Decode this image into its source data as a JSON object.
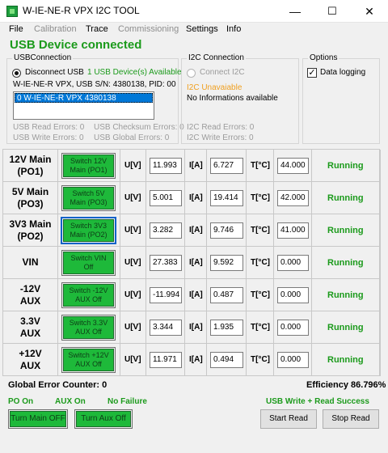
{
  "window": {
    "title": "W-IE-NE-R VPX I2C TOOL",
    "minimize_glyph": "—",
    "maximize_glyph": "☐",
    "close_glyph": "✕"
  },
  "menu": {
    "file": "File",
    "calibration": "Calibration",
    "trace": "Trace",
    "commissioning": "Commissioning",
    "settings": "Settings",
    "info": "Info"
  },
  "status": {
    "usb": "USB Device connected"
  },
  "usb": {
    "title": "USBConnection",
    "disconnect_label": "Disconnect USB",
    "available": "1 USB Device(s) Available",
    "device_info": "W-IE-NE-R VPX, USB S/N: 4380138, PID: 0018, V",
    "list_item": "0 W-IE-NE-R VPX 4380138",
    "read_errors": "USB Read Errors: 0",
    "checksum_errors": "USB Checksum Errors: 0",
    "write_errors": "USB Write Errors: 0",
    "global_errors": "USB Global Errors: 0"
  },
  "i2c": {
    "title": "I2C Connection",
    "connect_label": "Connect I2C",
    "unavailable": "I2C Unavaiable",
    "no_info": "No Informations available",
    "read_errors": "I2C Read Errors: 0",
    "write_errors": "I2C Write Errors: 0"
  },
  "options": {
    "title": "Options",
    "logging_label": "Data logging",
    "logging_checked": "✓"
  },
  "columns": {
    "voltage": "U[V]",
    "current": "I[A]",
    "temperature": "T[°C]"
  },
  "rows": [
    {
      "label": "12V Main\n(PO1)",
      "switch": "Switch 12V\nMain (PO1)",
      "u": "11.993",
      "i": "6.727",
      "t": "44.000",
      "state": "Running"
    },
    {
      "label": "5V Main\n(PO3)",
      "switch": "Switch 5V\nMain (PO3)",
      "u": "5.001",
      "i": "19.414",
      "t": "42.000",
      "state": "Running"
    },
    {
      "label": "3V3 Main\n(PO2)",
      "switch": "Switch 3V3\nMain (PO2)",
      "u": "3.282",
      "i": "9.746",
      "t": "41.000",
      "state": "Running"
    },
    {
      "label": "VIN",
      "switch": "Switch VIN\nOff",
      "u": "27.383",
      "i": "9.592",
      "t": "0.000",
      "state": "Running"
    },
    {
      "label": "-12V\nAUX",
      "switch": "Switch -12V\nAUX Off",
      "u": "-11.994",
      "i": "0.487",
      "t": "0.000",
      "state": "Running"
    },
    {
      "label": "3.3V\nAUX",
      "switch": "Switch 3.3V\nAUX Off",
      "u": "3.344",
      "i": "1.935",
      "t": "0.000",
      "state": "Running"
    },
    {
      "label": "+12V\nAUX",
      "switch": "Switch +12V\nAUX Off",
      "u": "11.971",
      "i": "0.494",
      "t": "0.000",
      "state": "Running"
    }
  ],
  "footer": {
    "global_error_counter": "Global Error Counter: 0",
    "efficiency": "Efficiency 86.796%",
    "po_on": "PO On",
    "aux_on": "AUX On",
    "no_failure": "No Failure",
    "usb_result": "USB Write + Read Success",
    "turn_main_off": "Turn Main OFF",
    "turn_aux_off": "Turn Aux Off",
    "start_read": "Start Read",
    "stop_read": "Stop Read"
  },
  "colors": {
    "status_green": "#1b9a1b",
    "switch_green": "#1eb93a",
    "warning_orange": "#f0a020",
    "selection_blue": "#0078d7"
  }
}
